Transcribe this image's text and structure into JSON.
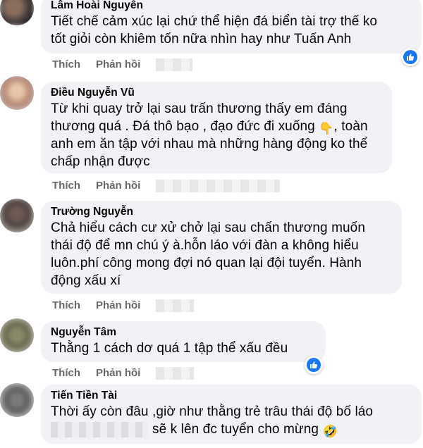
{
  "comments": [
    {
      "author": "Lâm Hoài Nguyễn",
      "lines": [
        "Tiết chế cảm xúc lại chứ thể hiện đá biển tài trợ thế ko",
        "tốt giỏi còn khiêm tốn nữa nhìn hay như Tuấn Anh"
      ],
      "like_label": "Thích",
      "reply_label": "Phản hồi",
      "reaction": "like-icon"
    },
    {
      "author": "Điều Nguyễn Vũ",
      "lines": [
        "Từ khi quay trở lại sau trấn thương thấy em đáng",
        "thương quá . Đá thô bạo , đạo đức đi xuống",
        ", toàn",
        "anh em ăn tập với nhau mà những hàng động ko thể",
        "chấp nhận được"
      ],
      "emoji": "👇",
      "like_label": "Thích",
      "reply_label": "Phản hồi"
    },
    {
      "author": "Trường Nguyễn",
      "lines": [
        "Chả hiểu cách cư xử chở lại sau chấn thương muốn",
        "thái độ để mn chú ý à.hỗn láo với đàn a không hiểu",
        "luôn.phí công mong đợi nó quan lại đội tuyển. Hành",
        "động xấu xí"
      ],
      "like_label": "Thích",
      "reply_label": "Phản hồi"
    },
    {
      "author": "Nguyễn Tâm",
      "lines": [
        "Thằng 1 cách dơ quá 1 tập thể xấu đều"
      ],
      "like_label": "Thích",
      "reply_label": "Phản hồi",
      "reaction": "like-icon"
    },
    {
      "author": "Tiến Tiền Tài",
      "lines": [
        "Thời ấy còn đâu ,giờ như thằng trẻ trâu thái độ bố láo",
        "sẽ k lên đc tuyển cho mừng"
      ],
      "emoji": "🤣"
    }
  ],
  "colors": {
    "bubble": "#f0f2f5",
    "meta": "#65676b",
    "like_blue": "#1877f2"
  }
}
